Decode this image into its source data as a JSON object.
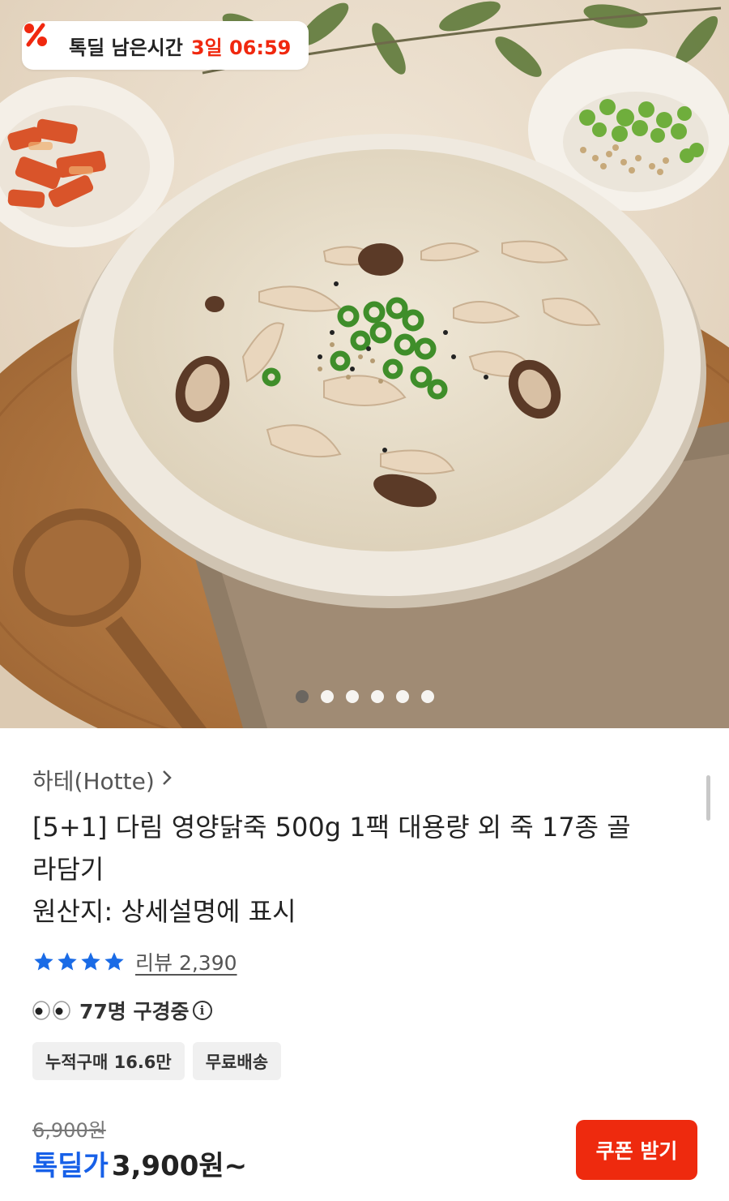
{
  "hero": {
    "image_alt": "",
    "deal_timer": {
      "label": "톡딜 남은시간",
      "time": "3일 06:59",
      "icon": "percent-icon"
    },
    "carousel": {
      "count": 6,
      "active_index": 0
    }
  },
  "product": {
    "brand": "하테(Hotte)",
    "title": "[5+1] 다림 영양닭죽 500g 1팩 대용량 외 죽 17종 골라담기",
    "origin": "원산지: 상세설명에 표시",
    "rating": {
      "stars": 4,
      "max": 4,
      "review_label": "리뷰 2,390"
    },
    "viewing": {
      "text": "77명 구경중",
      "icon": "eyes-icon"
    },
    "tags": [
      "누적구매 16.6만",
      "무료배송"
    ],
    "price": {
      "original": "6,900원",
      "deal_label": "톡딜가",
      "deal_value": "3,900원~"
    },
    "coupon_button": "쿠폰 받기"
  },
  "colors": {
    "accent_red": "#ee2a0e",
    "timer_red": "#f0280f",
    "deal_blue": "#1760e8",
    "star_blue": "#1a6be6"
  }
}
